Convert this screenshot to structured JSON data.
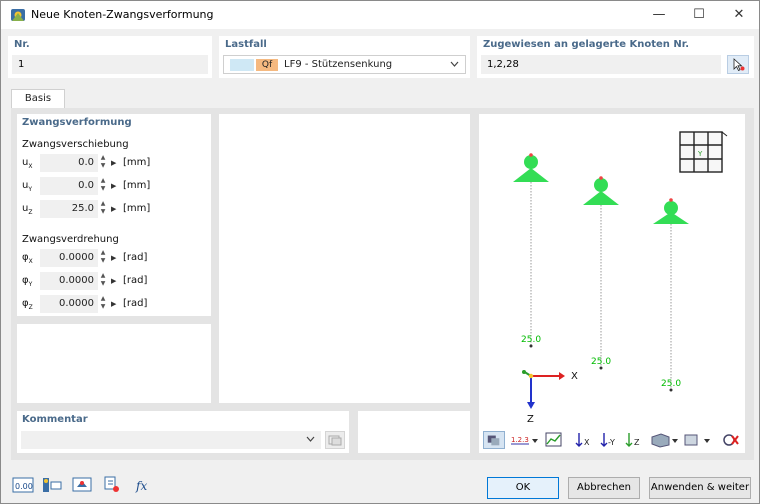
{
  "window": {
    "title": "Neue Knoten-Zwangsverformung",
    "minimize": "—",
    "maximize": "☐",
    "close": "✕"
  },
  "nr": {
    "label": "Nr.",
    "value": "1"
  },
  "lastfall": {
    "label": "Lastfall",
    "badge": "Qf",
    "value": "LF9 - Stützensenkung",
    "badge_color": "#f5b980",
    "swatch_color": "#cfe8f5"
  },
  "assigned": {
    "label": "Zugewiesen an gelagerte Knoten Nr.",
    "value": "1,2,28"
  },
  "tabs": [
    {
      "label": "Basis"
    }
  ],
  "zwangsverformung": {
    "title": "Zwangsverformung",
    "verschiebung_title": "Zwangsverschiebung",
    "verdrehung_title": "Zwangsverdrehung",
    "rows": [
      {
        "axis": "u",
        "sub": "X",
        "value": "0.0",
        "unit": "[mm]"
      },
      {
        "axis": "u",
        "sub": "Y",
        "value": "0.0",
        "unit": "[mm]"
      },
      {
        "axis": "u",
        "sub": "Z",
        "value": "25.0",
        "unit": "[mm]"
      },
      {
        "axis": "φ",
        "sub": "X",
        "value": "0.0000",
        "unit": "[rad]"
      },
      {
        "axis": "φ",
        "sub": "Y",
        "value": "0.0000",
        "unit": "[rad]"
      },
      {
        "axis": "φ",
        "sub": "Z",
        "value": "0.0000",
        "unit": "[rad]"
      }
    ]
  },
  "kommentar": {
    "label": "Kommentar",
    "value": ""
  },
  "preview": {
    "support_color": "#33dd55",
    "load_color": "#00bb00",
    "load_labels": [
      "25.0",
      "25.0",
      "25.0"
    ],
    "axis_x": "X",
    "axis_z": "Z"
  },
  "buttons": {
    "ok": "OK",
    "cancel": "Abbrechen",
    "apply_next": "Anwenden & weiter"
  },
  "bottom_tools": [
    "units-icon",
    "node-table-icon",
    "view-icon",
    "support-icon",
    "formula-icon"
  ],
  "units_icon_text": "0.00",
  "formula_icon_text": "f𝑥"
}
